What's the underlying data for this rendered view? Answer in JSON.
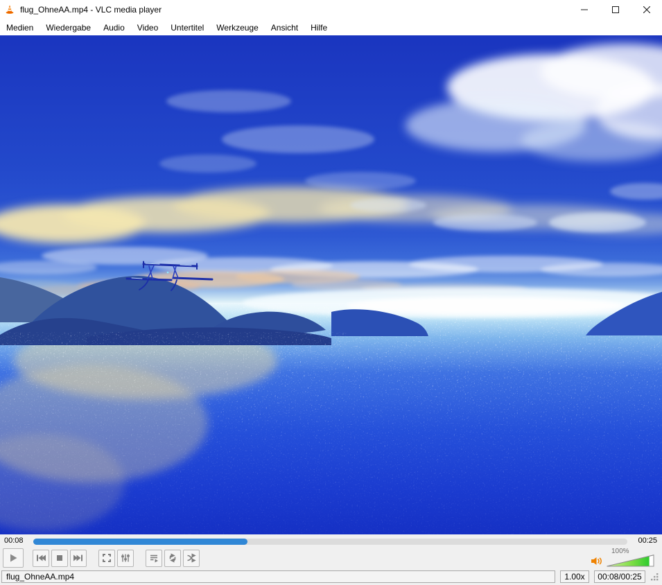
{
  "colors": {
    "seek_accent": "#3087d6",
    "volume_green": "#2ecb2e",
    "cone_orange": "#f57900",
    "chrome_bg": "#f0f0f0",
    "sky_top": "#1a35bf",
    "sea_deep": "#1530c4"
  },
  "titlebar": {
    "title": "flug_OhneAA.mp4 - VLC media player"
  },
  "menu": {
    "items": [
      "Medien",
      "Wiedergabe",
      "Audio",
      "Video",
      "Untertitel",
      "Werkzeuge",
      "Ansicht",
      "Hilfe"
    ]
  },
  "transport": {
    "elapsed": "00:08",
    "total": "00:25",
    "progress_pct": 36
  },
  "volume": {
    "label": "100%",
    "level_pct": 88
  },
  "statusbar": {
    "filename": "flug_OhneAA.mp4",
    "speed": "1.00x",
    "time": "00:08/00:25"
  }
}
